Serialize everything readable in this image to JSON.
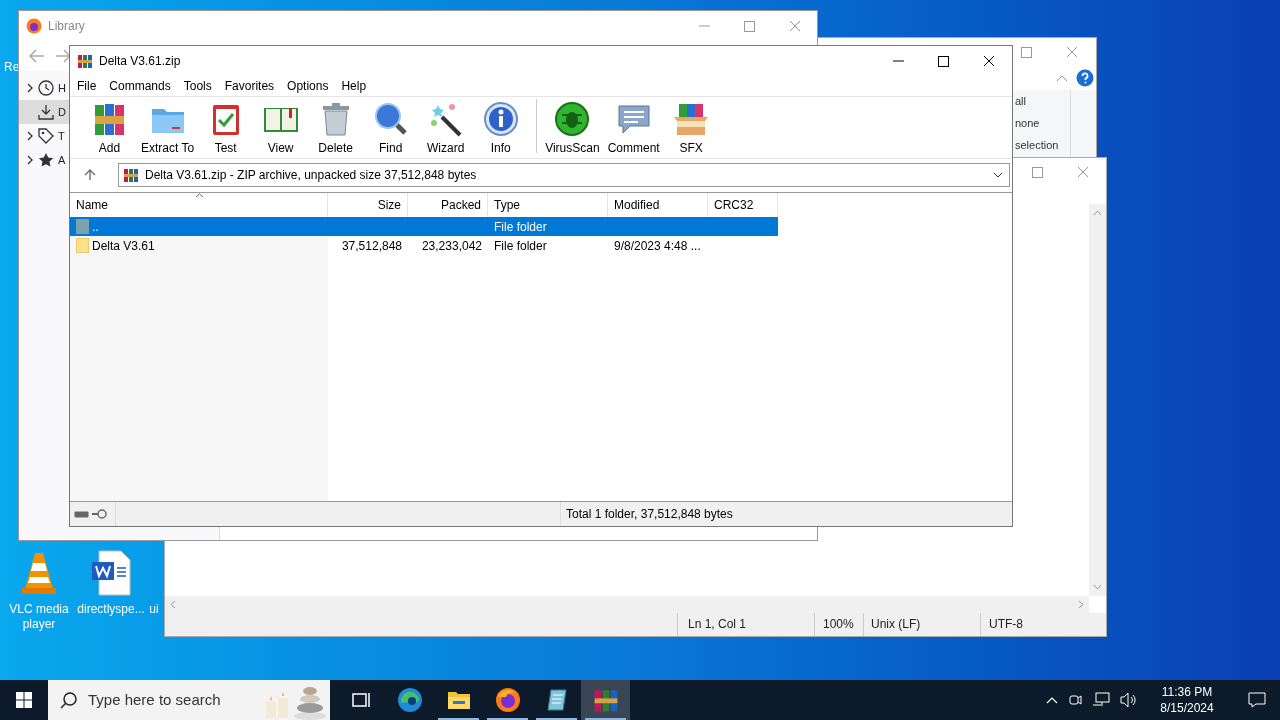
{
  "desktop": {
    "edge_text": "Re",
    "icons": [
      {
        "label": "VLC media player",
        "kind": "vlc"
      },
      {
        "label": "directlyspe...",
        "kind": "word"
      },
      {
        "label": "ui",
        "kind": "none"
      }
    ]
  },
  "library_window": {
    "title": "Library",
    "sidebar_items": [
      {
        "label": "H",
        "kind": "clock",
        "expandable": true,
        "selected": false
      },
      {
        "label": "D",
        "kind": "download",
        "expandable": false,
        "selected": true
      },
      {
        "label": "T",
        "kind": "tag",
        "expandable": true,
        "selected": false
      },
      {
        "label": "A",
        "kind": "star",
        "expandable": true,
        "selected": false
      }
    ]
  },
  "explorer_window": {
    "ribbon_items": [
      "all",
      "none",
      "selection"
    ]
  },
  "editor_window": {
    "status_bar": [
      "Ln 1, Col 1",
      "100%",
      "Unix (LF)",
      "UTF-8"
    ]
  },
  "archiver_window": {
    "title": "Delta V3.61.zip",
    "menu": [
      "File",
      "Commands",
      "Tools",
      "Favorites",
      "Options",
      "Help"
    ],
    "toolbar": [
      {
        "label": "Add",
        "kind": "add"
      },
      {
        "label": "Extract To",
        "kind": "extract"
      },
      {
        "label": "Test",
        "kind": "test"
      },
      {
        "label": "View",
        "kind": "view"
      },
      {
        "label": "Delete",
        "kind": "delete"
      },
      {
        "label": "Find",
        "kind": "find"
      },
      {
        "label": "Wizard",
        "kind": "wizard"
      },
      {
        "label": "Info",
        "kind": "info"
      },
      {
        "label": "VirusScan",
        "kind": "virusscan"
      },
      {
        "label": "Comment",
        "kind": "comment"
      },
      {
        "label": "SFX",
        "kind": "sfx"
      }
    ],
    "address": "Delta V3.61.zip - ZIP archive, unpacked size 37,512,848 bytes",
    "columns": [
      "Name",
      "Size",
      "Packed",
      "Type",
      "Modified",
      "CRC32"
    ],
    "rows": [
      {
        "name": "..",
        "kind": "parent",
        "type": "File folder",
        "selected": true
      },
      {
        "name": "Delta V3.61",
        "kind": "folder",
        "size": "37,512,848",
        "packed": "23,233,042",
        "type": "File folder",
        "modified": "9/8/2023 4:48 ...",
        "selected": false
      }
    ],
    "status": "Total 1 folder, 37,512,848 bytes"
  },
  "taskbar": {
    "search_placeholder": "Type here to search",
    "apps": [
      {
        "kind": "taskview",
        "running": false,
        "selected": false
      },
      {
        "kind": "edge",
        "running": false,
        "selected": false
      },
      {
        "kind": "explorer",
        "running": true,
        "selected": false
      },
      {
        "kind": "firefox",
        "running": true,
        "selected": false
      },
      {
        "kind": "notepad",
        "running": true,
        "selected": false
      },
      {
        "kind": "winrar",
        "running": true,
        "selected": true
      }
    ],
    "time": "11:36 PM",
    "date": "8/15/2024"
  }
}
